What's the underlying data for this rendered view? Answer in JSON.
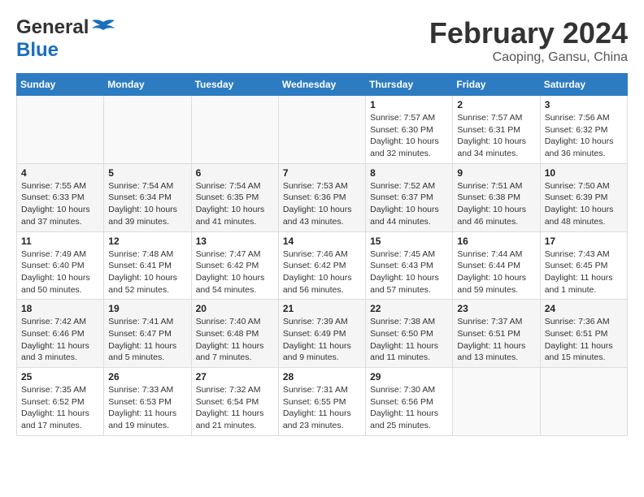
{
  "header": {
    "logo_line1": "General",
    "logo_line2": "Blue",
    "title": "February 2024",
    "subtitle": "Caoping, Gansu, China"
  },
  "weekdays": [
    "Sunday",
    "Monday",
    "Tuesday",
    "Wednesday",
    "Thursday",
    "Friday",
    "Saturday"
  ],
  "weeks": [
    [
      {
        "day": "",
        "info": ""
      },
      {
        "day": "",
        "info": ""
      },
      {
        "day": "",
        "info": ""
      },
      {
        "day": "",
        "info": ""
      },
      {
        "day": "1",
        "info": "Sunrise: 7:57 AM\nSunset: 6:30 PM\nDaylight: 10 hours\nand 32 minutes."
      },
      {
        "day": "2",
        "info": "Sunrise: 7:57 AM\nSunset: 6:31 PM\nDaylight: 10 hours\nand 34 minutes."
      },
      {
        "day": "3",
        "info": "Sunrise: 7:56 AM\nSunset: 6:32 PM\nDaylight: 10 hours\nand 36 minutes."
      }
    ],
    [
      {
        "day": "4",
        "info": "Sunrise: 7:55 AM\nSunset: 6:33 PM\nDaylight: 10 hours\nand 37 minutes."
      },
      {
        "day": "5",
        "info": "Sunrise: 7:54 AM\nSunset: 6:34 PM\nDaylight: 10 hours\nand 39 minutes."
      },
      {
        "day": "6",
        "info": "Sunrise: 7:54 AM\nSunset: 6:35 PM\nDaylight: 10 hours\nand 41 minutes."
      },
      {
        "day": "7",
        "info": "Sunrise: 7:53 AM\nSunset: 6:36 PM\nDaylight: 10 hours\nand 43 minutes."
      },
      {
        "day": "8",
        "info": "Sunrise: 7:52 AM\nSunset: 6:37 PM\nDaylight: 10 hours\nand 44 minutes."
      },
      {
        "day": "9",
        "info": "Sunrise: 7:51 AM\nSunset: 6:38 PM\nDaylight: 10 hours\nand 46 minutes."
      },
      {
        "day": "10",
        "info": "Sunrise: 7:50 AM\nSunset: 6:39 PM\nDaylight: 10 hours\nand 48 minutes."
      }
    ],
    [
      {
        "day": "11",
        "info": "Sunrise: 7:49 AM\nSunset: 6:40 PM\nDaylight: 10 hours\nand 50 minutes."
      },
      {
        "day": "12",
        "info": "Sunrise: 7:48 AM\nSunset: 6:41 PM\nDaylight: 10 hours\nand 52 minutes."
      },
      {
        "day": "13",
        "info": "Sunrise: 7:47 AM\nSunset: 6:42 PM\nDaylight: 10 hours\nand 54 minutes."
      },
      {
        "day": "14",
        "info": "Sunrise: 7:46 AM\nSunset: 6:42 PM\nDaylight: 10 hours\nand 56 minutes."
      },
      {
        "day": "15",
        "info": "Sunrise: 7:45 AM\nSunset: 6:43 PM\nDaylight: 10 hours\nand 57 minutes."
      },
      {
        "day": "16",
        "info": "Sunrise: 7:44 AM\nSunset: 6:44 PM\nDaylight: 10 hours\nand 59 minutes."
      },
      {
        "day": "17",
        "info": "Sunrise: 7:43 AM\nSunset: 6:45 PM\nDaylight: 11 hours\nand 1 minute."
      }
    ],
    [
      {
        "day": "18",
        "info": "Sunrise: 7:42 AM\nSunset: 6:46 PM\nDaylight: 11 hours\nand 3 minutes."
      },
      {
        "day": "19",
        "info": "Sunrise: 7:41 AM\nSunset: 6:47 PM\nDaylight: 11 hours\nand 5 minutes."
      },
      {
        "day": "20",
        "info": "Sunrise: 7:40 AM\nSunset: 6:48 PM\nDaylight: 11 hours\nand 7 minutes."
      },
      {
        "day": "21",
        "info": "Sunrise: 7:39 AM\nSunset: 6:49 PM\nDaylight: 11 hours\nand 9 minutes."
      },
      {
        "day": "22",
        "info": "Sunrise: 7:38 AM\nSunset: 6:50 PM\nDaylight: 11 hours\nand 11 minutes."
      },
      {
        "day": "23",
        "info": "Sunrise: 7:37 AM\nSunset: 6:51 PM\nDaylight: 11 hours\nand 13 minutes."
      },
      {
        "day": "24",
        "info": "Sunrise: 7:36 AM\nSunset: 6:51 PM\nDaylight: 11 hours\nand 15 minutes."
      }
    ],
    [
      {
        "day": "25",
        "info": "Sunrise: 7:35 AM\nSunset: 6:52 PM\nDaylight: 11 hours\nand 17 minutes."
      },
      {
        "day": "26",
        "info": "Sunrise: 7:33 AM\nSunset: 6:53 PM\nDaylight: 11 hours\nand 19 minutes."
      },
      {
        "day": "27",
        "info": "Sunrise: 7:32 AM\nSunset: 6:54 PM\nDaylight: 11 hours\nand 21 minutes."
      },
      {
        "day": "28",
        "info": "Sunrise: 7:31 AM\nSunset: 6:55 PM\nDaylight: 11 hours\nand 23 minutes."
      },
      {
        "day": "29",
        "info": "Sunrise: 7:30 AM\nSunset: 6:56 PM\nDaylight: 11 hours\nand 25 minutes."
      },
      {
        "day": "",
        "info": ""
      },
      {
        "day": "",
        "info": ""
      }
    ]
  ]
}
